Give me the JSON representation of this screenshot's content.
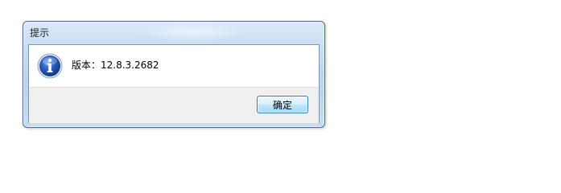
{
  "dialog": {
    "title": "提示",
    "icon": "info-icon",
    "message": "版本：12.8.3.2682",
    "ok_label": "确定"
  },
  "colors": {
    "titlebar": "#c4dbf2",
    "border": "#4f6b8a",
    "footer": "#f0f0f0",
    "button_border": "#3c7fb1",
    "icon_blue": "#1d4fa8"
  }
}
